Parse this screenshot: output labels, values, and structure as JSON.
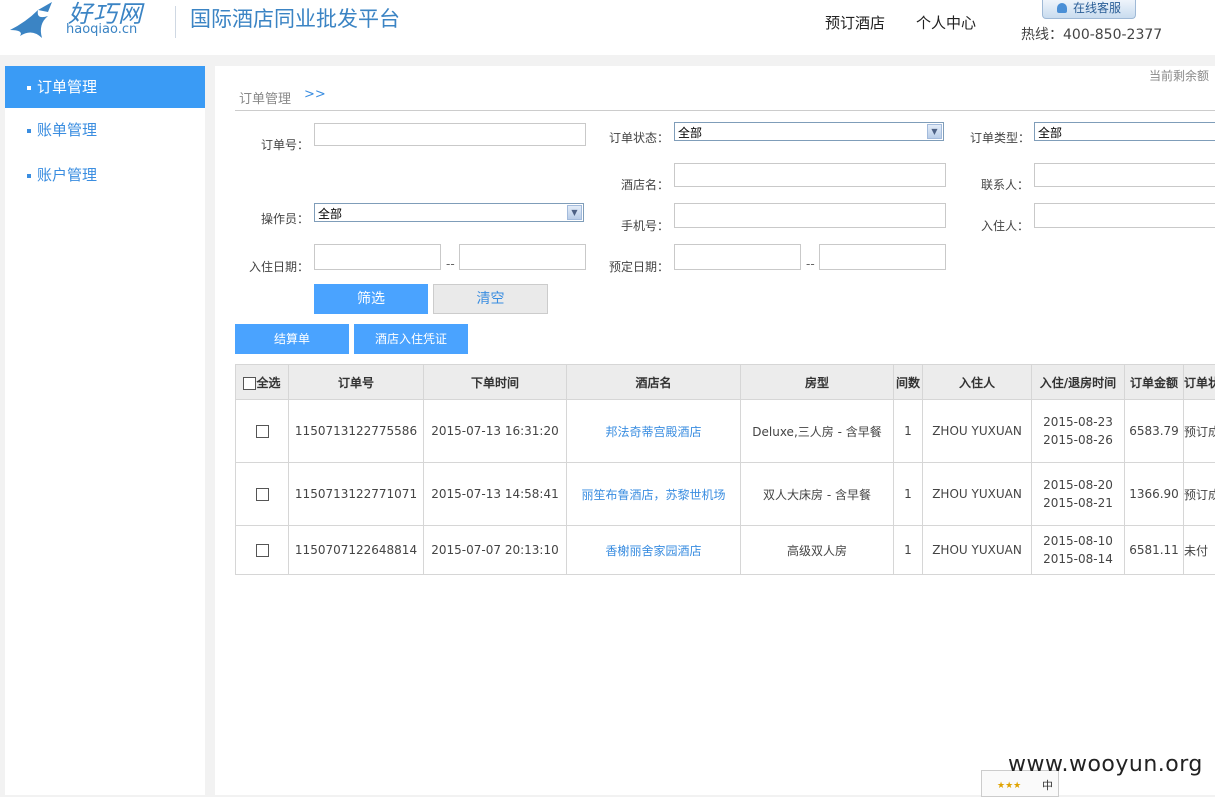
{
  "header": {
    "logo_cn": "好巧网",
    "logo_en": "haoqiao.cn",
    "tagline": "国际酒店同业批发平台",
    "nav": [
      "预订酒店",
      "个人中心"
    ],
    "online_service": "在线客服",
    "hotline": "热线：400-850-2377"
  },
  "sidebar": {
    "items": [
      {
        "label": "订单管理",
        "active": true
      },
      {
        "label": "账单管理",
        "active": false
      },
      {
        "label": "账户管理",
        "active": false
      }
    ]
  },
  "main": {
    "balance": "当前剩余额",
    "breadcrumb": "订单管理",
    "breadcrumb_arrow": ">>"
  },
  "filters": {
    "order_no_label": "订单号：",
    "order_status_label": "订单状态：",
    "order_status_value": "全部",
    "order_type_label": "订单类型：",
    "order_type_value": "全部",
    "hotel_label": "酒店名：",
    "contact_label": "联系人：",
    "operator_label": "操作员：",
    "operator_value": "全部",
    "phone_label": "手机号：",
    "guest_label": "入住人：",
    "checkin_label": "入住日期：",
    "booking_label": "预定日期：",
    "range_sep": "--",
    "filter_button": "筛选",
    "clear_button": "清空"
  },
  "actions": {
    "settle_button": "结算单",
    "voucher_button": "酒店入住凭证"
  },
  "table": {
    "headers": {
      "select_all": "全选",
      "order_no": "订单号",
      "order_time": "下单时间",
      "hotel": "酒店名",
      "room_type": "房型",
      "rooms": "间数",
      "guest": "入住人",
      "stay": "入住/退房时间",
      "amount": "订单金额",
      "status": "订单状"
    },
    "rows": [
      {
        "order_no": "1150713122775586",
        "order_time": "2015-07-13 16:31:20",
        "hotel": "邦法奇蒂宫殿酒店",
        "room_type": "Deluxe,三人房 - 含早餐",
        "rooms": "1",
        "guest": "ZHOU YUXUAN",
        "checkin": "2015-08-23",
        "checkout": "2015-08-26",
        "amount": "6583.79",
        "status": "预订成"
      },
      {
        "order_no": "1150713122771071",
        "order_time": "2015-07-13 14:58:41",
        "hotel": "丽笙布鲁酒店，苏黎世机场",
        "room_type": "双人大床房 - 含早餐",
        "rooms": "1",
        "guest": "ZHOU YUXUAN",
        "checkin": "2015-08-20",
        "checkout": "2015-08-21",
        "amount": "1366.90",
        "status": "预订成"
      },
      {
        "order_no": "1150707122648814",
        "order_time": "2015-07-07 20:13:10",
        "hotel": "香榭丽舍家园酒店",
        "room_type": "高级双人房",
        "rooms": "1",
        "guest": "ZHOU YUXUAN",
        "checkin": "2015-08-10",
        "checkout": "2015-08-14",
        "amount": "6581.11",
        "status": "未付"
      }
    ]
  },
  "watermark": {
    "text": "www.wooyun.org",
    "stars": "★★★",
    "zh": "中"
  }
}
